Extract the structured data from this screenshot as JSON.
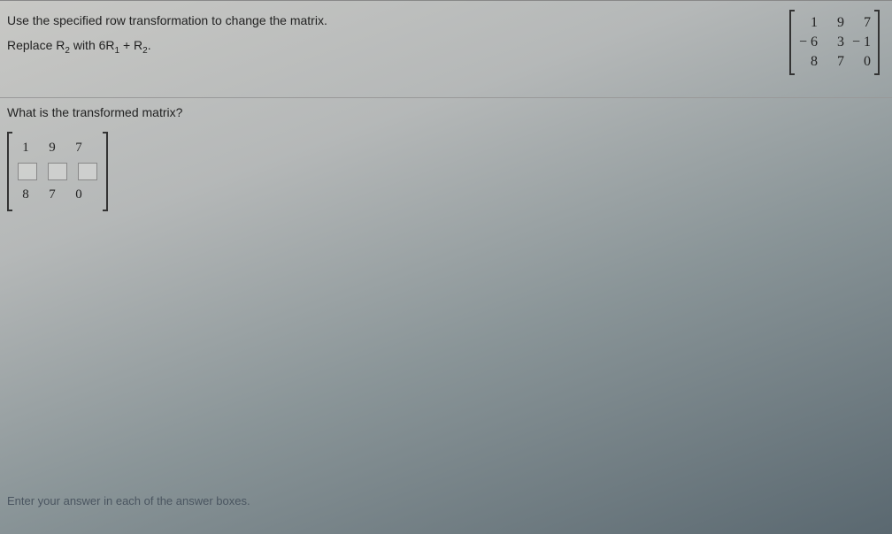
{
  "question": {
    "instruction": "Use the specified row transformation to change the matrix.",
    "operation_prefix": "Replace R",
    "operation_sub1": "2",
    "operation_mid": " with 6R",
    "operation_sub2": "1",
    "operation_mid2": " + R",
    "operation_sub3": "2",
    "operation_suffix": "."
  },
  "given_matrix": {
    "rows": [
      [
        "1",
        "9",
        "7"
      ],
      [
        "− 6",
        "3",
        "− 1"
      ],
      [
        "8",
        "7",
        "0"
      ]
    ]
  },
  "prompt": "What is the transformed matrix?",
  "answer_matrix": {
    "row1": [
      "1",
      "9",
      "7"
    ],
    "row3": [
      "8",
      "7",
      "0"
    ]
  },
  "footer": "Enter your answer in each of the answer boxes."
}
